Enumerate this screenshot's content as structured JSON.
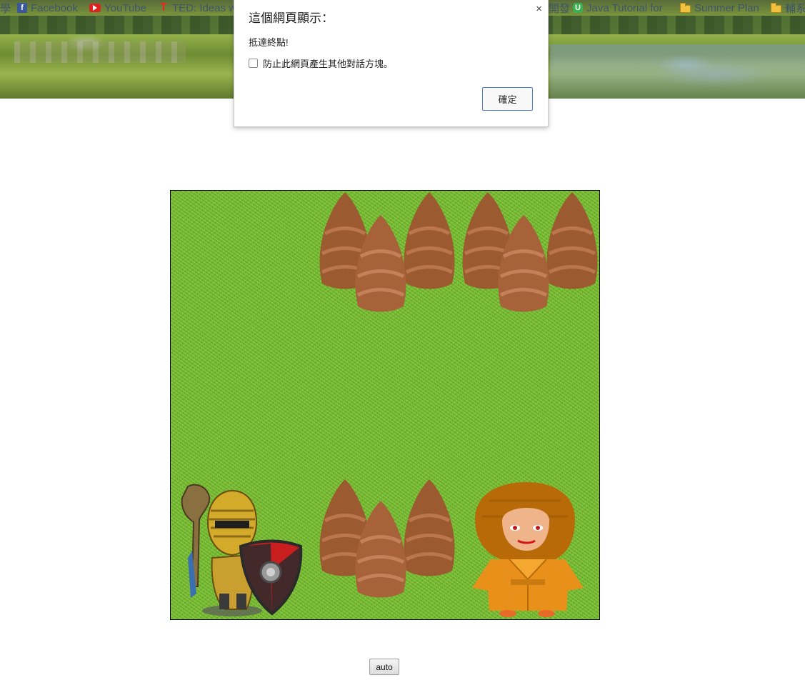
{
  "bookmarks": {
    "items": [
      {
        "label": "學",
        "icon": "partial-icon"
      },
      {
        "label": "Facebook",
        "icon": "facebook-icon"
      },
      {
        "label": "YouTube",
        "icon": "youtube-icon"
      },
      {
        "label": "TED: Ideas w",
        "icon": "ted-icon"
      },
      {
        "label": "開發",
        "icon": "partial-icon"
      },
      {
        "label": "Java Tutorial for",
        "icon": "udemy-icon"
      },
      {
        "label": "Summer Plan",
        "icon": "folder-icon"
      },
      {
        "label": "輔系",
        "icon": "folder-icon"
      }
    ]
  },
  "dialog": {
    "title": "這個網頁顯示：",
    "message": "抵達終點!",
    "checkbox_label": "防止此網頁產生其他對話方塊。",
    "checkbox_checked": false,
    "ok_label": "確定",
    "close_glyph": "×"
  },
  "game": {
    "player": "knight-with-shield",
    "goal": "monk",
    "obstacles": "bamboo-shoots"
  },
  "controls": {
    "auto_label": "auto"
  },
  "colors": {
    "grass": "#6fb330",
    "shoot": "#a05a2c",
    "dialog_button_border": "#4d7fcc",
    "monk_robe": "#e8901a"
  }
}
